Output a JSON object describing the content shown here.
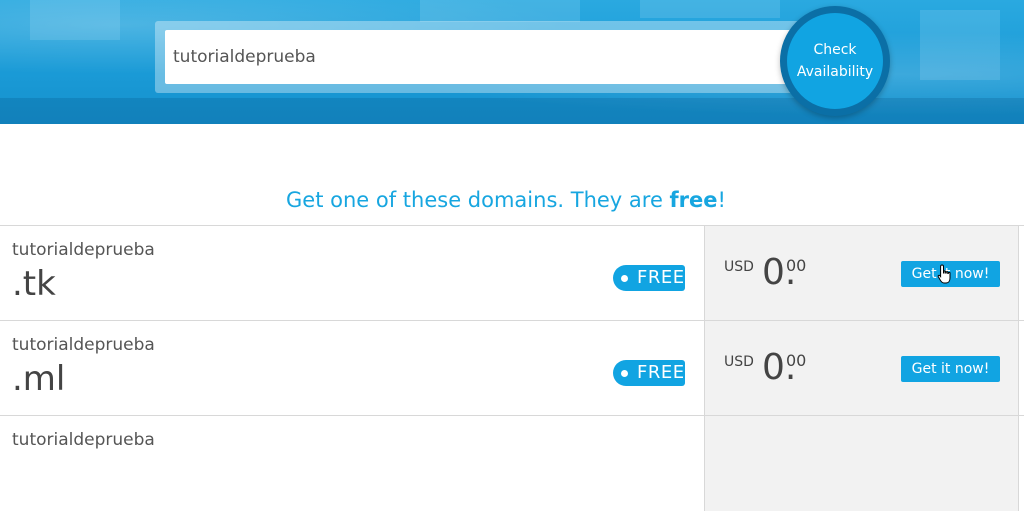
{
  "search": {
    "value": "tutorialdeprueba",
    "button_label_line1": "Check",
    "button_label_line2": "Availability"
  },
  "headline": {
    "prefix": "Get one of these domains. They are ",
    "emphasis": "free",
    "suffix": "!"
  },
  "results": [
    {
      "name": "tutorialdeprueba",
      "tld": ".tk",
      "badge": "FREE",
      "currency": "USD",
      "price_whole": "0.",
      "price_cents": "00",
      "button": "Get it now!"
    },
    {
      "name": "tutorialdeprueba",
      "tld": ".ml",
      "badge": "FREE",
      "currency": "USD",
      "price_whole": "0.",
      "price_cents": "00",
      "button": "Get it now!"
    },
    {
      "name": "tutorialdeprueba"
    }
  ],
  "colors": {
    "accent": "#11a4e2",
    "headline": "#17a6e0",
    "price_panel": "#f2f2f2"
  },
  "icons": [
    "pointer-hand-cursor"
  ]
}
